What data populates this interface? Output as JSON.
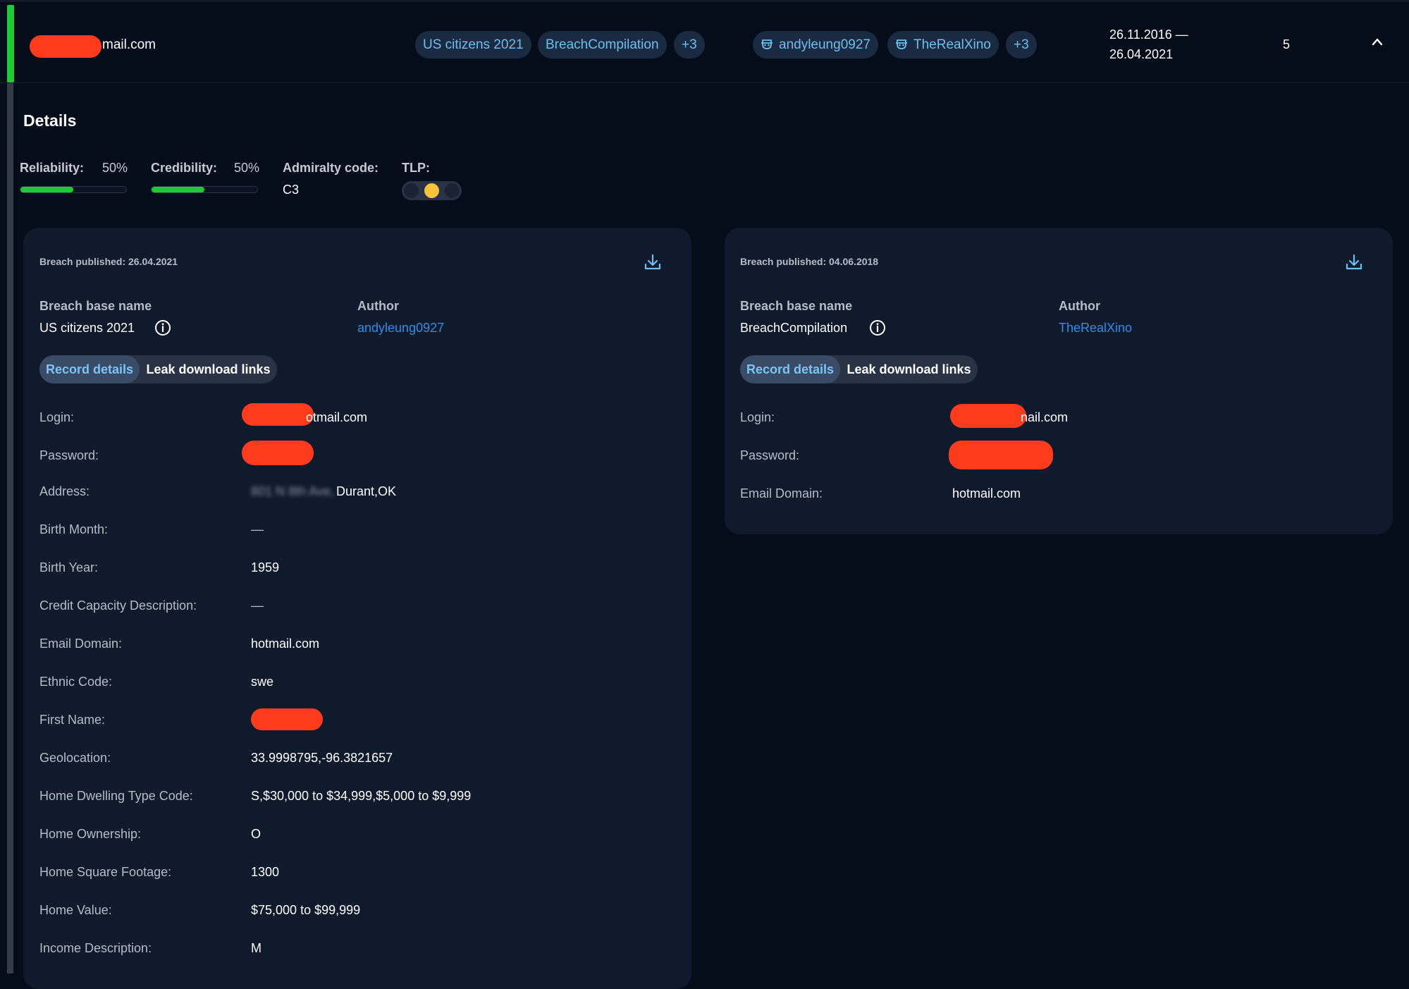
{
  "row": {
    "email_suffix": "mail.com",
    "breach_chips": [
      "US citizens 2021",
      "BreachCompilation",
      "+3"
    ],
    "author_chips": [
      "andyleung0927",
      "TheRealXino",
      "+3"
    ],
    "date_start": "26.11.2016 —",
    "date_end": "26.04.2021",
    "count": "5",
    "accent_color": "#1ecb34",
    "chevron_icon": "chevron-up-icon"
  },
  "details": {
    "title": "Details",
    "reliability_label": "Reliability:",
    "reliability_value": "50%",
    "reliability_percent": 50,
    "credibility_label": "Credibility:",
    "credibility_value": "50%",
    "credibility_percent": 50,
    "admiralty_label": "Admiralty code:",
    "admiralty_value": "C3",
    "tlp_label": "TLP:",
    "tlp_active": "amber",
    "tlp_active_color": "#f8c23a"
  },
  "cards": [
    {
      "published": "Breach published: 26.04.2021",
      "base_name_label": "Breach base name",
      "base_name": "US citizens 2021",
      "author_label": "Author",
      "author": "andyleung0927",
      "tab_active": "Record details",
      "tab_inactive": "Leak download links",
      "fields": [
        {
          "label": "Login:",
          "value": "otmail.com"
        },
        {
          "label": "Password:",
          "value": ""
        },
        {
          "label": "Address:",
          "value_blurred": "801 N 8th Ave,",
          "value": "Durant,OK"
        },
        {
          "label": "Birth Month:",
          "value": "—"
        },
        {
          "label": "Birth Year:",
          "value": "1959"
        },
        {
          "label": "Credit Capacity Description:",
          "value": "—"
        },
        {
          "label": "Email Domain:",
          "value": "hotmail.com"
        },
        {
          "label": "Ethnic Code:",
          "value": "swe"
        },
        {
          "label": "First Name:",
          "value": ""
        },
        {
          "label": "Geolocation:",
          "value": "33.9998795,-96.3821657"
        },
        {
          "label": "Home Dwelling Type Code:",
          "value": "S,$30,000 to $34,999,$5,000 to $9,999"
        },
        {
          "label": "Home Ownership:",
          "value": "O"
        },
        {
          "label": "Home Square Footage:",
          "value": "1300"
        },
        {
          "label": "Home Value:",
          "value": "$75,000 to $99,999"
        },
        {
          "label": "Income Description:",
          "value": "M"
        }
      ]
    },
    {
      "published": "Breach published: 04.06.2018",
      "base_name_label": "Breach base name",
      "base_name": "BreachCompilation",
      "author_label": "Author",
      "author": "TheRealXino",
      "tab_active": "Record details",
      "tab_inactive": "Leak download links",
      "fields": [
        {
          "label": "Login:",
          "value": "nail.com"
        },
        {
          "label": "Password:",
          "value": ""
        },
        {
          "label": "Email Domain:",
          "value": "hotmail.com"
        }
      ]
    }
  ],
  "colors": {
    "background": "#050c1a",
    "card": "#0f1a2c",
    "chip_text": "#6cbff0",
    "link": "#2f8fe5",
    "redaction": "#ff3b1e",
    "progress": "#1ecb34"
  }
}
